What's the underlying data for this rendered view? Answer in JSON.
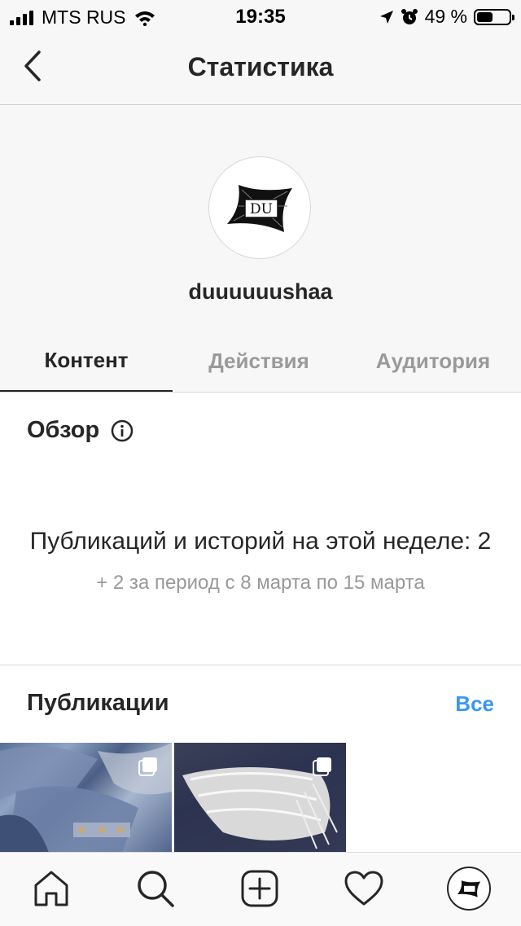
{
  "status_bar": {
    "carrier": "MTS RUS",
    "time": "19:35",
    "battery_text": "49 %",
    "battery_level": 0.49,
    "icons": [
      "signal-icon",
      "wifi-icon",
      "location-icon",
      "alarm-icon",
      "battery-icon"
    ]
  },
  "nav": {
    "title": "Статистика",
    "back_icon": "chevron-left-icon"
  },
  "profile": {
    "username": "duuuuuushaa",
    "logo_text": "DU"
  },
  "tabs": [
    {
      "label": "Контент",
      "active": true
    },
    {
      "label": "Действия",
      "active": false
    },
    {
      "label": "Аудитория",
      "active": false
    }
  ],
  "overview": {
    "title": "Обзор",
    "main_text": "Публикаций и историй на этой неделе: 2",
    "sub_text": "+ 2 за период с 8 марта по 15 марта"
  },
  "publications": {
    "title": "Публикации",
    "see_all": "Все"
  },
  "bottom_nav": [
    "home-icon",
    "search-icon",
    "add-icon",
    "heart-icon",
    "profile-icon"
  ],
  "colors": {
    "accent": "#3897f0",
    "text": "#262626",
    "muted": "#999999",
    "header_bg": "#f7f7f7"
  }
}
